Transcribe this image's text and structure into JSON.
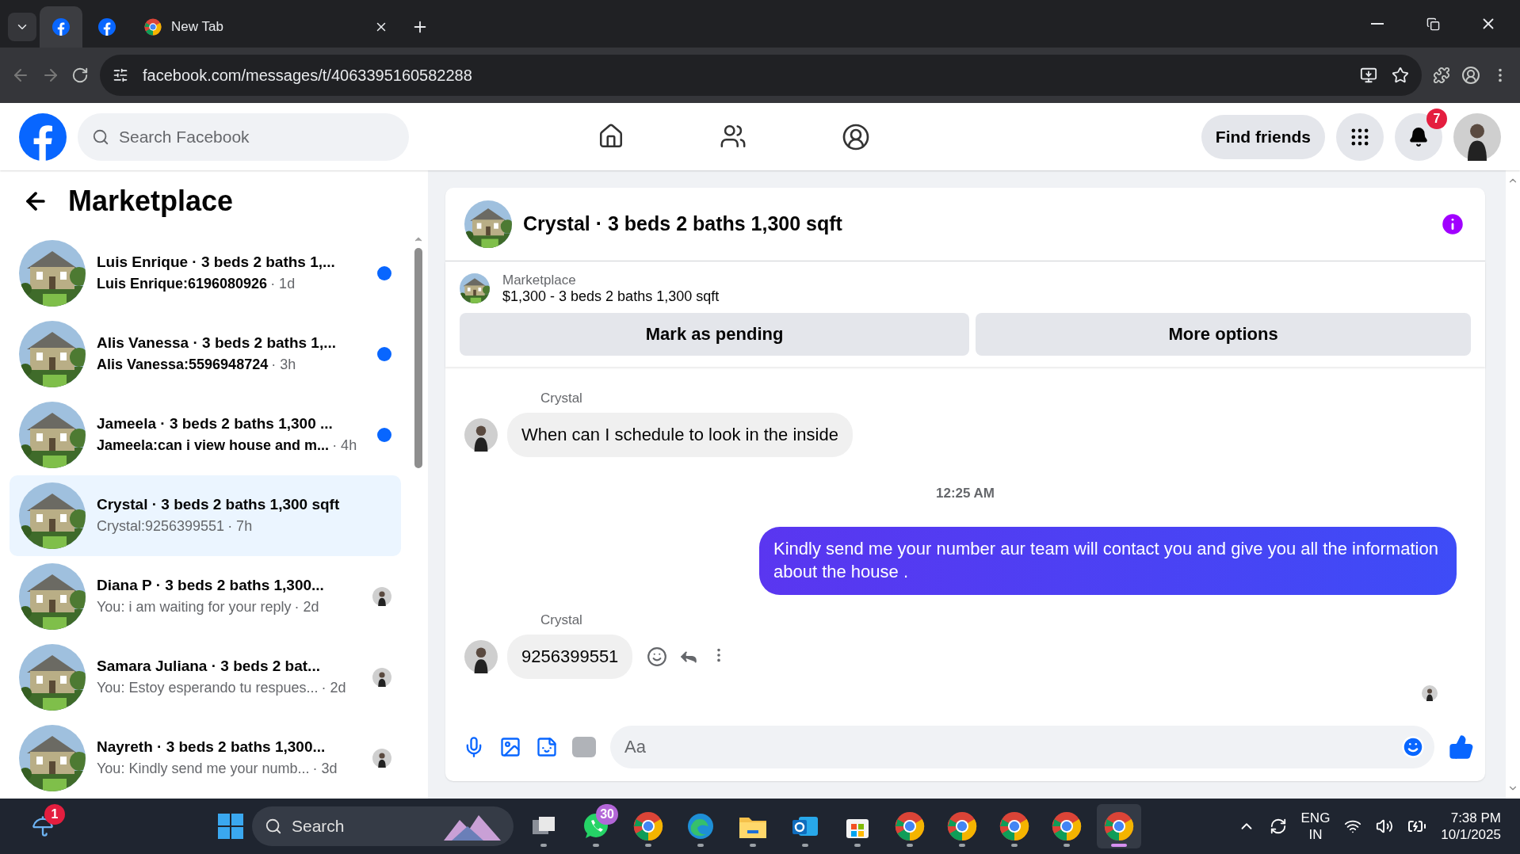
{
  "browser": {
    "tabs": [
      {
        "kind": "facebook",
        "selected": true
      },
      {
        "kind": "facebook",
        "selected": false
      },
      {
        "kind": "chrome",
        "label": "New Tab",
        "selected": false
      }
    ],
    "address": "facebook.com/messages/t/4063395160582288"
  },
  "header": {
    "search": {
      "placeholder": "Search Facebook"
    },
    "find_friends": "Find friends",
    "notification_count": "7"
  },
  "sidebar": {
    "title": "Marketplace",
    "conversations": [
      {
        "title": "Luis Enrique · 3 beds 2 baths 1,...",
        "preview": "Luis Enrique:6196080926",
        "time": "· 1d",
        "unread": true,
        "selected": false
      },
      {
        "title": "Alis Vanessa · 3 beds 2 baths 1,...",
        "preview": "Alis Vanessa:5596948724",
        "time": "· 3h",
        "unread": true,
        "selected": false
      },
      {
        "title": "Jameela · 3 beds 2 baths 1,300 ...",
        "preview": "Jameela:can i view house and m...",
        "time": "· 4h",
        "unread": true,
        "selected": false
      },
      {
        "title": "Crystal · 3 beds 2 baths 1,300 sqft",
        "preview": "Crystal:9256399551",
        "time": "· 7h",
        "unread": false,
        "selected": true
      },
      {
        "title": "Diana P · 3 beds 2 baths 1,300...",
        "preview": "You: i am waiting for your reply",
        "time": "· 2d",
        "unread": false,
        "selected": false
      },
      {
        "title": "Samara Juliana · 3 beds 2 bat...",
        "preview": "You: Estoy esperando tu respues...",
        "time": "· 2d",
        "unread": false,
        "selected": false
      },
      {
        "title": "Nayreth · 3 beds 2 baths 1,300...",
        "preview": "You: Kindly send me your numb...",
        "time": "· 3d",
        "unread": false,
        "selected": false
      }
    ]
  },
  "chat": {
    "title": "Crystal · 3 beds 2 baths 1,300 sqft",
    "listing": {
      "label": "Marketplace",
      "price": "$1,300 - 3 beds 2 baths 1,300 sqft"
    },
    "buttons": [
      "Mark as pending",
      "More options"
    ],
    "messages": [
      {
        "kind": "incoming",
        "sender": "Crystal",
        "text": "When can I schedule to look in the inside",
        "hovered": false
      },
      {
        "kind": "timestamp",
        "text": "12:25 AM"
      },
      {
        "kind": "outgoing",
        "text": "Kindly send me your number aur team will contact you and give you all the information about the house ."
      },
      {
        "kind": "incoming",
        "sender": "Crystal",
        "text": "9256399551",
        "hovered": true
      }
    ],
    "composer": {
      "placeholder": "Aa"
    }
  },
  "taskbar": {
    "weather_badge": "1",
    "search": "Search",
    "apps": [
      {
        "kind": "taskview",
        "selected": false
      },
      {
        "kind": "whatsapp",
        "badge": "30",
        "selected": false
      },
      {
        "kind": "chrome",
        "selected": false
      },
      {
        "kind": "edge",
        "selected": false
      },
      {
        "kind": "folder",
        "selected": false
      },
      {
        "kind": "outlook",
        "selected": false
      },
      {
        "kind": "store",
        "selected": false
      },
      {
        "kind": "chrome",
        "selected": false
      },
      {
        "kind": "chrome",
        "selected": false
      },
      {
        "kind": "chrome",
        "selected": false
      },
      {
        "kind": "chrome",
        "selected": false
      },
      {
        "kind": "chrome",
        "selected": true
      }
    ],
    "language": "ENG",
    "region": "IN",
    "time": "7:38 PM",
    "date": "10/1/2025"
  }
}
